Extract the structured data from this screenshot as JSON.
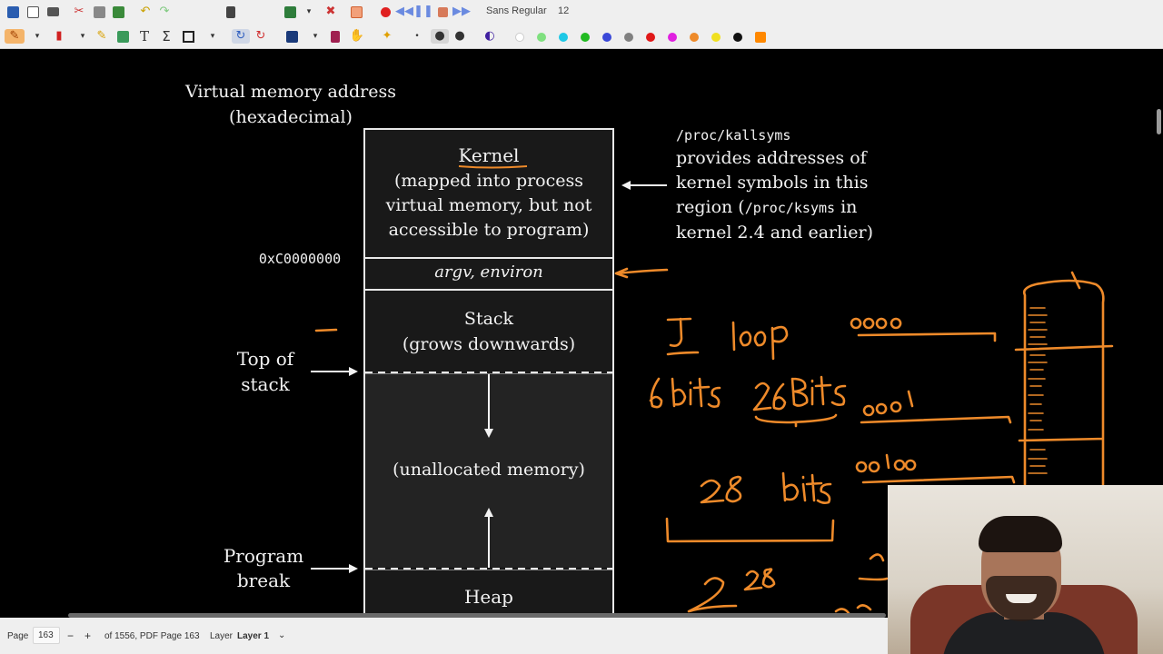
{
  "toolbar": {
    "font_name": "Sans Regular",
    "font_size": "12",
    "colors": [
      "#ffffff",
      "#7fe07f",
      "#1ec8e6",
      "#22bb22",
      "#3a48d8",
      "#808080",
      "#e01818",
      "#e020e0",
      "#ee8a2a",
      "#f0e020",
      "#111111",
      "#ff8800"
    ],
    "icons": [
      "save-icon",
      "new-page-icon",
      "open-folder-icon",
      "cut-icon",
      "copy-icon",
      "paste-icon",
      "undo-icon",
      "redo-icon",
      "export-icon",
      "pdf-icon",
      "close-doc-icon",
      "grid-icon",
      "record-icon",
      "rewind-icon",
      "pause-icon",
      "stop-icon",
      "fast-forward-icon"
    ]
  },
  "diagram": {
    "address_heading": "Virtual memory address\n(hexadecimal)",
    "kernel_title": "Kernel",
    "kernel_desc": "(mapped into process\nvirtual memory, but not\naccessible to program)",
    "kernel_addr": "0xC0000000",
    "argv_label": "argv, environ",
    "stack_label": "Stack\n(grows downwards)",
    "top_of_stack": "Top of\nstack",
    "unalloc_label": "(unallocated memory)",
    "program_break": "Program\nbreak",
    "heap_label": "Heap",
    "kallsyms_path": "/proc/kallsyms",
    "kallsyms_text1": "provides addresses of\nkernel symbols in this\nregion (",
    "ksyms_path": "/proc/ksyms",
    "kallsyms_text2": " in",
    "kallsyms_text3": "kernel 2.4 and earlier)"
  },
  "annotations": {
    "color": "#ee8a2a",
    "handwriting": [
      "J",
      "loop",
      "6 bits",
      "26 Bits",
      "0000",
      "0001",
      "0010",
      "28 bits",
      "2^28"
    ],
    "exponent_base": "2",
    "exponent_power": "28"
  },
  "statusbar": {
    "page_label": "Page",
    "page_value": "163",
    "minus": "−",
    "plus": "+",
    "page_info": "of 1556, PDF Page 163",
    "layer_label": "Layer",
    "layer_value": "Layer 1",
    "layer_caret": "⌄"
  }
}
